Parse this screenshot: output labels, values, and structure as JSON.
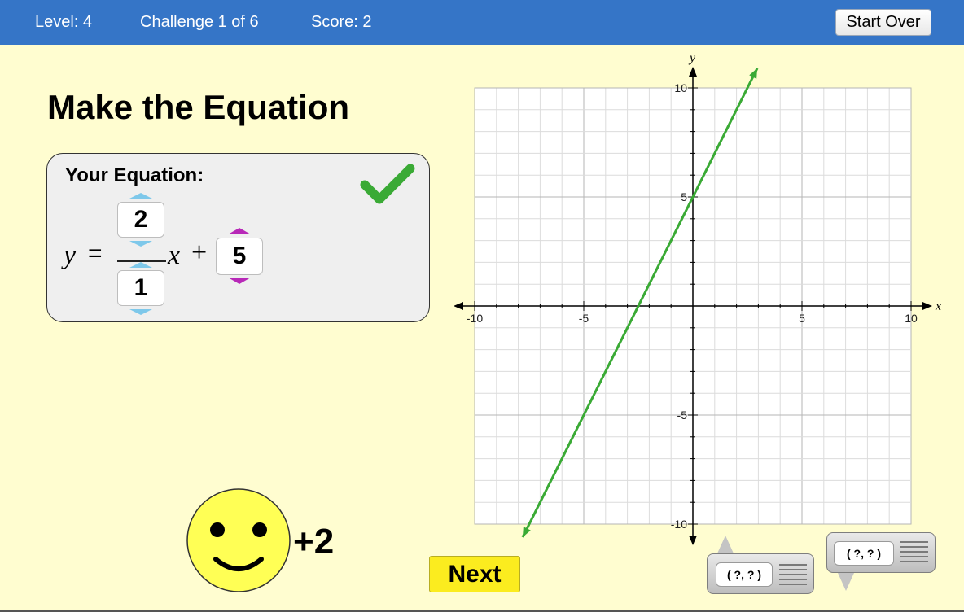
{
  "header": {
    "level": "Level: 4",
    "challenge": "Challenge 1 of 6",
    "score": "Score: 2",
    "start_over_label": "Start Over"
  },
  "title": "Make the Equation",
  "equation_panel": {
    "label": "Your Equation:",
    "y_symbol": "y",
    "equals": "=",
    "x_symbol": "x",
    "plus": "+",
    "numerator": "2",
    "denominator": "1",
    "intercept": "5",
    "status_icon": "check-icon"
  },
  "reward": {
    "icon": "smiley-face-icon",
    "points": "+2"
  },
  "next_label": "Next",
  "probes": [
    {
      "label": "( ?, ? )"
    },
    {
      "label": "( ?, ? )"
    }
  ],
  "graph": {
    "x_axis_label": "x",
    "y_axis_label": "y",
    "x_range": [
      -10,
      10
    ],
    "y_range": [
      -10,
      10
    ],
    "major_tick_labels_x": [
      "-10",
      "-5",
      "5",
      "10"
    ],
    "major_tick_labels_y": [
      "10",
      "5",
      "-5",
      "-10"
    ],
    "grid": true,
    "line": {
      "slope": 2,
      "intercept": 5,
      "color": "#3aaa35"
    }
  },
  "colors": {
    "header": "#3575c7",
    "background": "#fffdd0",
    "check": "#3aaa35",
    "next_button": "#fbec1f",
    "smiley": "#ffff55",
    "spinner_fraction": "#7ec8ea",
    "spinner_intercept": "#b829b8"
  }
}
